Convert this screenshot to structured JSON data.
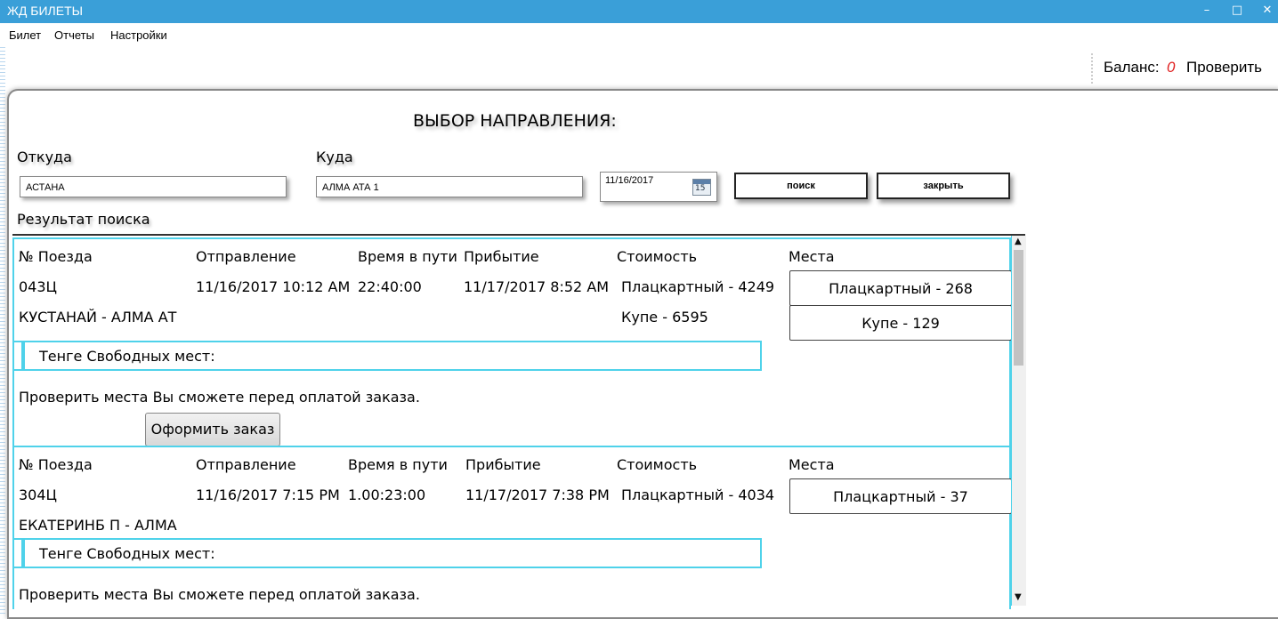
{
  "window": {
    "title": "ЖД БИЛЕТЫ",
    "minimize_glyph": "–",
    "maximize_glyph": "□",
    "close_glyph": "✕"
  },
  "menu": [
    "Билет",
    "Отчеты",
    "Настройки"
  ],
  "balance": {
    "label": "Баланс:",
    "value": "0",
    "value_color": "#e02020",
    "check_label": "Проверить"
  },
  "form": {
    "heading": "ВЫБОР НАПРАВЛЕНИЯ:",
    "from_label": "Откуда",
    "from_value": "АСТАНА",
    "to_label": "Куда",
    "to_value": "АЛМА АТА 1",
    "date_value": "11/16/2017",
    "calendar_icon_text": "15",
    "search_button": "поиск",
    "close_button": "закрыть",
    "results_label": "Результат поиска"
  },
  "columns": [
    "№ Поезда",
    "Отправление",
    "Время в пути",
    "Прибытие",
    "Стоимость",
    "Места"
  ],
  "trains": [
    {
      "number": "043Ц",
      "route": "КУСТАНАЙ  -  АЛМА АТ",
      "departure": "11/16/2017 10:12 AM",
      "duration": "22:40:00",
      "arrival": "11/17/2017 8:52 AM",
      "prices": [
        "Плацкартный  -  4249",
        "Купе  -  6595"
      ],
      "seats": [
        "Плацкартный  -  268",
        "Купе  -  129"
      ],
      "free_text": "Тенге  Свободных мест:",
      "note": "Проверить места Вы сможете перед оплатой заказа.",
      "order_button": "Оформить заказ"
    },
    {
      "number": "304Ц",
      "route": "ЕКАТЕРИНБ П  -  АЛМА",
      "departure": "11/16/2017 7:15 PM",
      "duration": "1.00:23:00",
      "arrival": "11/17/2017 7:38 PM",
      "prices": [
        "Плацкартный  -  4034"
      ],
      "seats": [
        "Плацкартный  -  37"
      ],
      "free_text": "Тенге  Свободных мест:",
      "note": "Проверить места Вы сможете перед оплатой заказа."
    }
  ],
  "colors": {
    "titlebar": "#3a9fd8",
    "accent_border": "#4fd2ea"
  }
}
